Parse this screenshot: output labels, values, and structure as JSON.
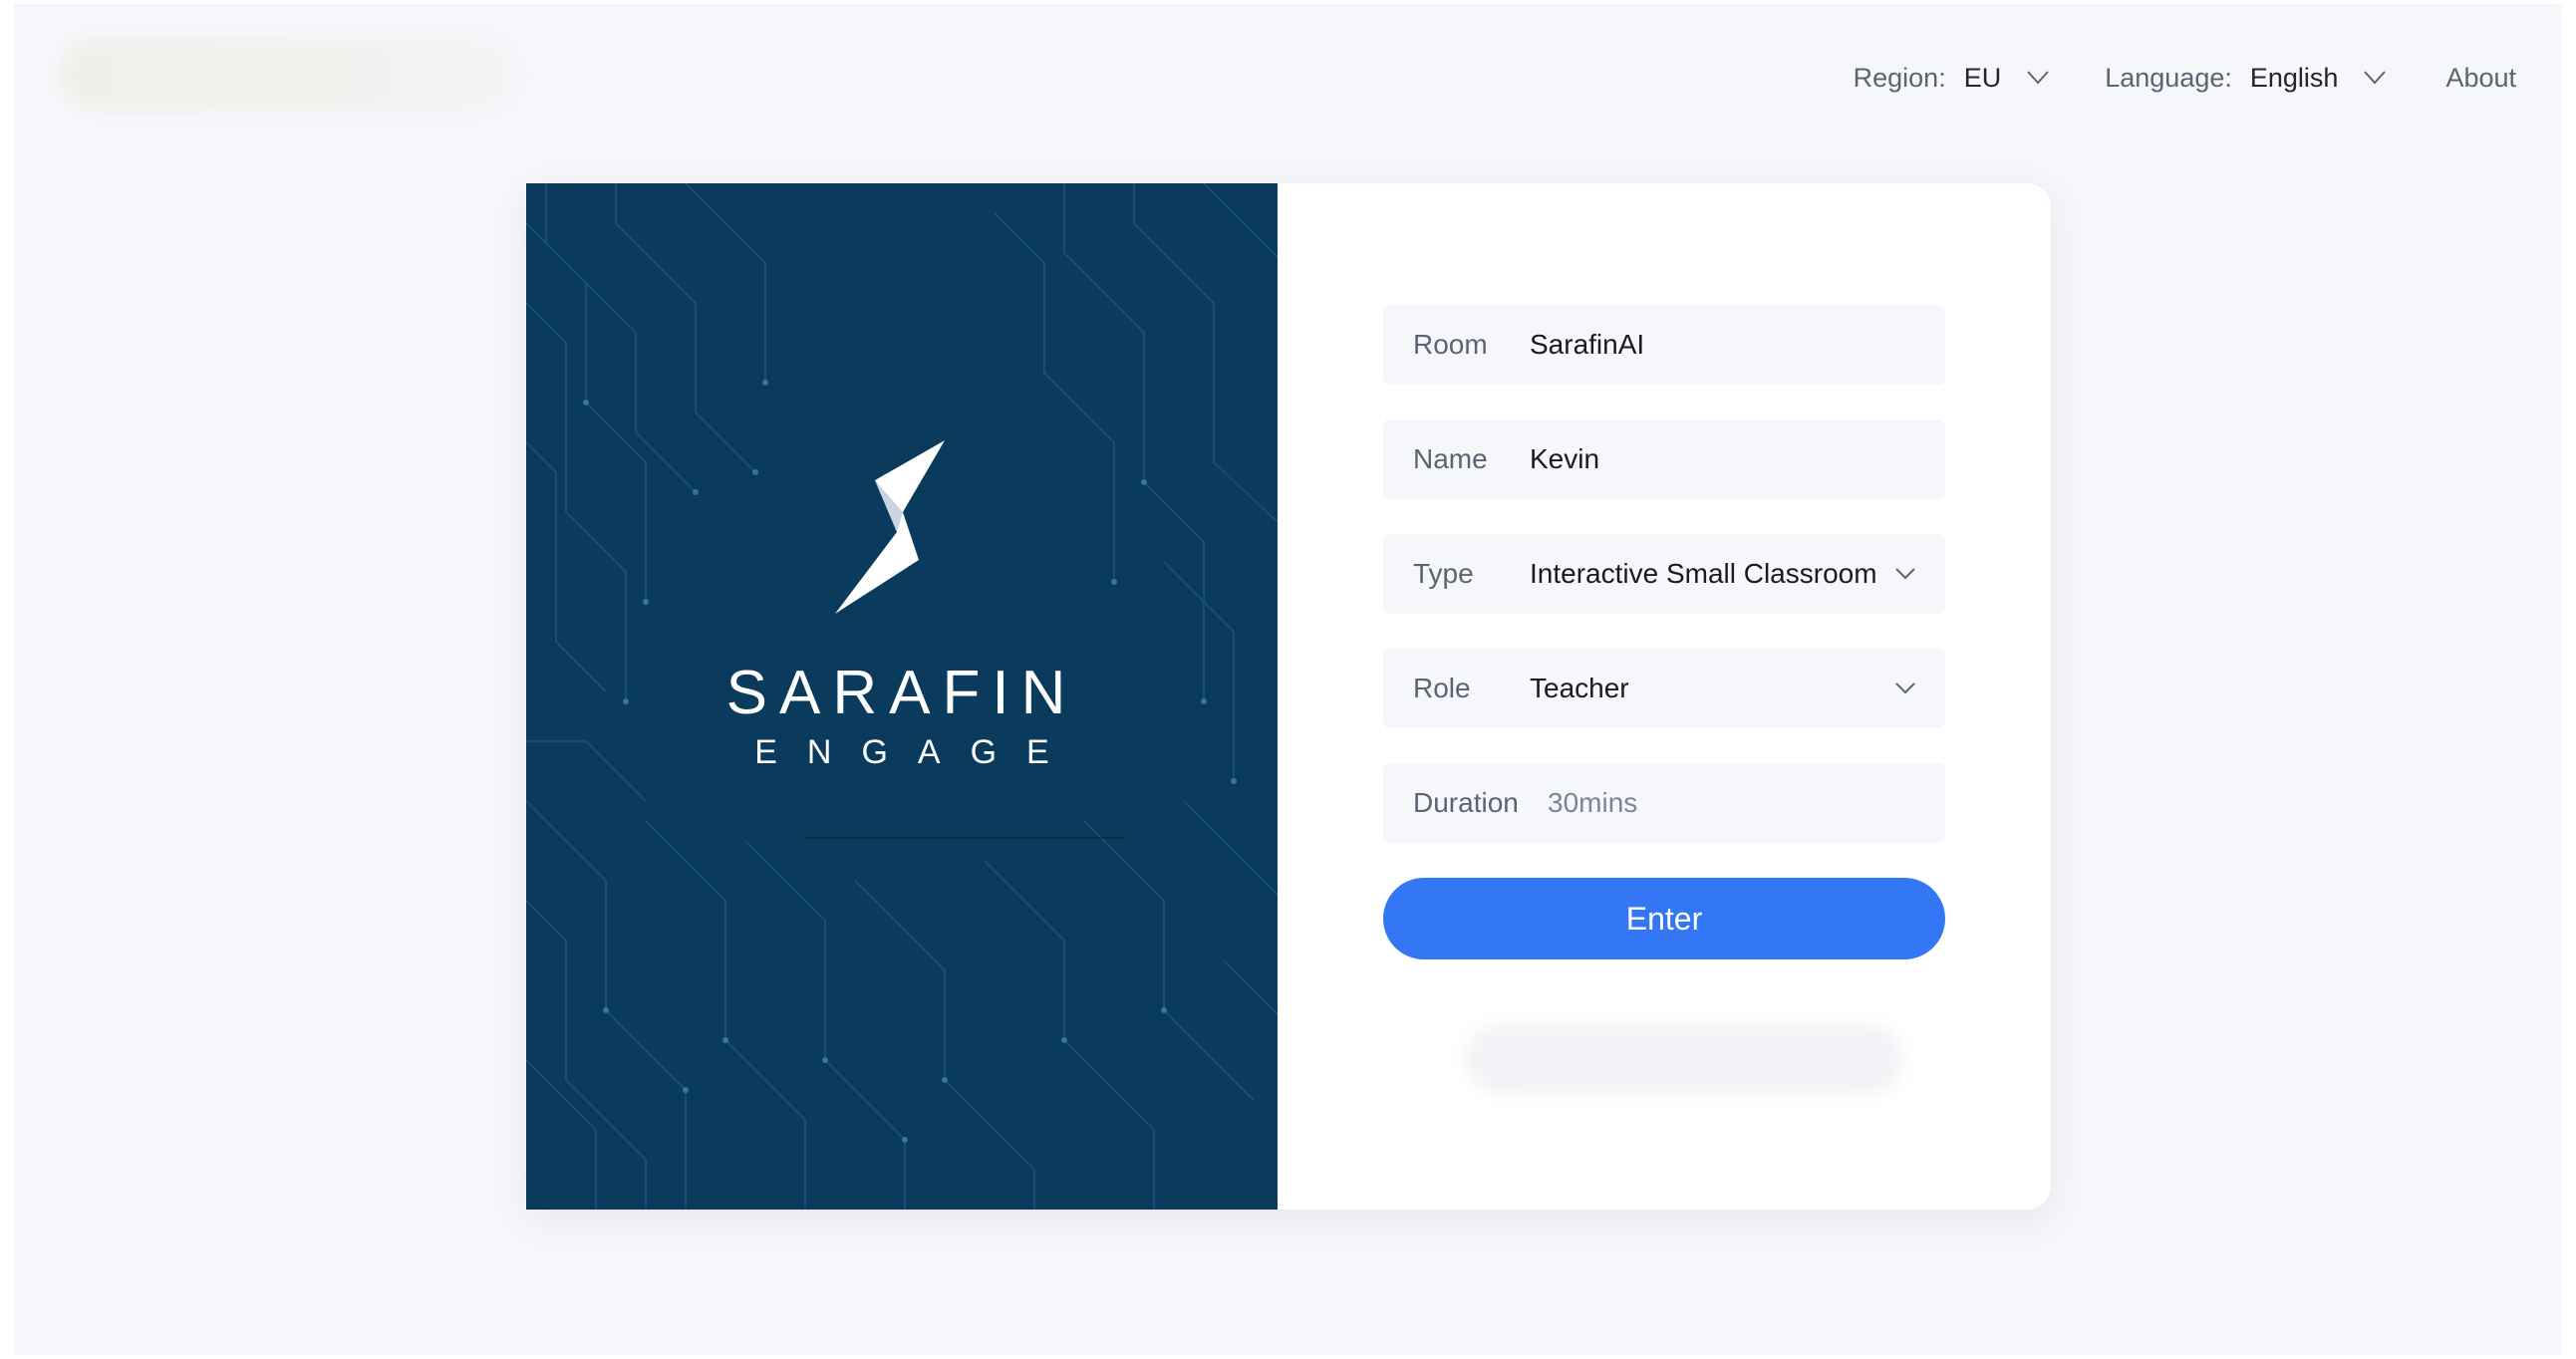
{
  "header": {
    "region_label": "Region:",
    "region_value": "EU",
    "language_label": "Language:",
    "language_value": "English",
    "about_label": "About"
  },
  "hero": {
    "brand_name": "SARAFIN",
    "brand_sub": "ENGAGE"
  },
  "form": {
    "room": {
      "label": "Room",
      "value": "SarafinAI"
    },
    "name": {
      "label": "Name",
      "value": "Kevin"
    },
    "type": {
      "label": "Type",
      "value": "Interactive Small Classroom"
    },
    "role": {
      "label": "Role",
      "value": "Teacher"
    },
    "duration": {
      "label": "Duration",
      "value": "30mins"
    },
    "enter_label": "Enter"
  },
  "colors": {
    "accent": "#3377f5",
    "hero_bg": "#0a3a5c",
    "page_bg": "#f6f7fb"
  },
  "icons": {
    "dropdown": "chevron-down-icon",
    "logo": "sarafin-bolt-logo"
  }
}
